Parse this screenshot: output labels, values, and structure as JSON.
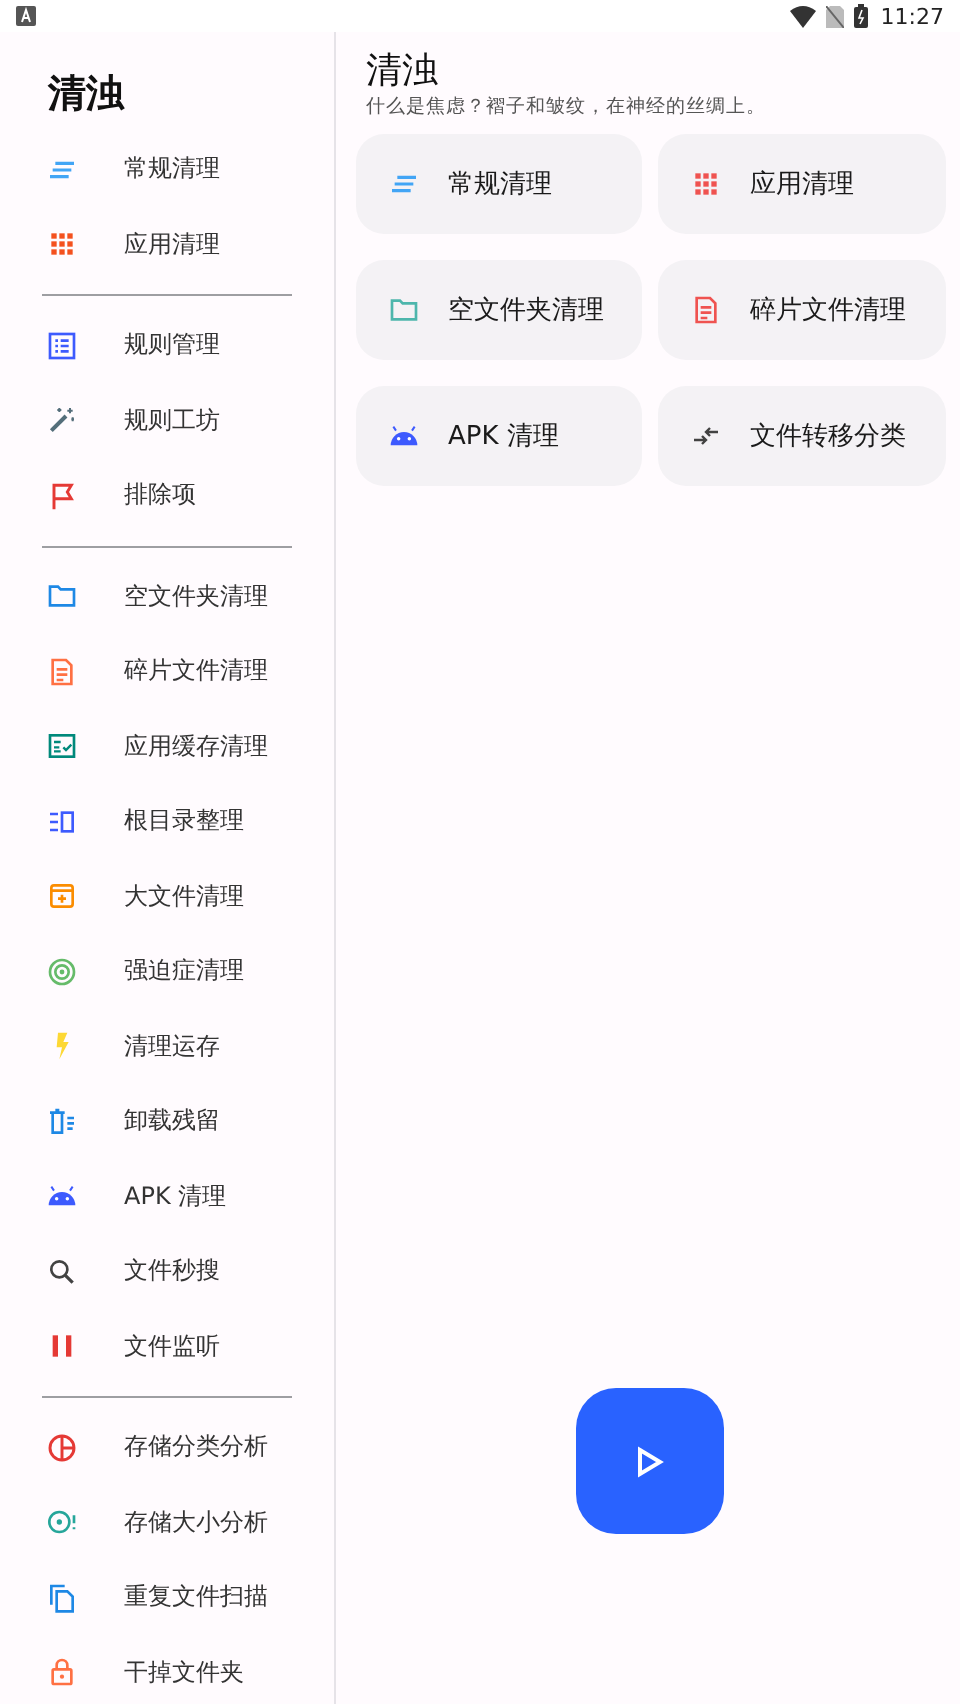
{
  "status_bar": {
    "time": "11:27"
  },
  "drawer": {
    "title": "清浊",
    "sections": [
      {
        "items": [
          {
            "label": "常规清理",
            "kind": "lines",
            "color": "#42a5f5"
          },
          {
            "label": "应用清理",
            "kind": "grid",
            "color": "#f4511e"
          }
        ]
      },
      {
        "items": [
          {
            "label": "规则管理",
            "kind": "list",
            "color": "#3d5afe"
          },
          {
            "label": "规则工坊",
            "kind": "wand",
            "color": "#546e7a"
          },
          {
            "label": "排除项",
            "kind": "flag",
            "color": "#e53935"
          }
        ]
      },
      {
        "items": [
          {
            "label": "空文件夹清理",
            "kind": "folder",
            "color": "#1e88e5"
          },
          {
            "label": "碎片文件清理",
            "kind": "doc",
            "color": "#ff7043"
          },
          {
            "label": "应用缓存清理",
            "kind": "cache",
            "color": "#00897b"
          },
          {
            "label": "根目录整理",
            "kind": "rootdir",
            "color": "#3d5afe"
          },
          {
            "label": "大文件清理",
            "kind": "bigfile",
            "color": "#fb8c00"
          },
          {
            "label": "强迫症清理",
            "kind": "radar",
            "color": "#66bb6a"
          },
          {
            "label": "清理运存",
            "kind": "bolt",
            "color": "#fdd835"
          },
          {
            "label": "卸载残留",
            "kind": "uninstall",
            "color": "#1e88e5"
          },
          {
            "label": "APK 清理",
            "kind": "android",
            "color": "#3d5afe"
          },
          {
            "label": "文件秒搜",
            "kind": "search",
            "color": "#424242"
          },
          {
            "label": "文件监听",
            "kind": "pause",
            "color": "#e53935"
          }
        ]
      },
      {
        "items": [
          {
            "label": "存储分类分析",
            "kind": "pie",
            "color": "#e53935"
          },
          {
            "label": "存储大小分析",
            "kind": "disk",
            "color": "#26a69a"
          },
          {
            "label": "重复文件扫描",
            "kind": "copy",
            "color": "#1e88e5"
          },
          {
            "label": "干掉文件夹",
            "kind": "lock",
            "color": "#ff7043"
          }
        ]
      }
    ]
  },
  "main": {
    "title": "清浊",
    "subtitle": "什么是焦虑？褶子和皱纹，在神经的丝绸上。",
    "cards": [
      {
        "label": "常规清理",
        "kind": "lines",
        "color": "#42a5f5"
      },
      {
        "label": "应用清理",
        "kind": "grid",
        "color": "#ef5350"
      },
      {
        "label": "空文件夹清理",
        "kind": "folder",
        "color": "#4db6ac"
      },
      {
        "label": "碎片文件清理",
        "kind": "doc",
        "color": "#ef5350"
      },
      {
        "label": "APK 清理",
        "kind": "android",
        "color": "#3d5afe"
      },
      {
        "label": "文件转移分类",
        "kind": "transfer",
        "color": "#424242"
      }
    ]
  }
}
